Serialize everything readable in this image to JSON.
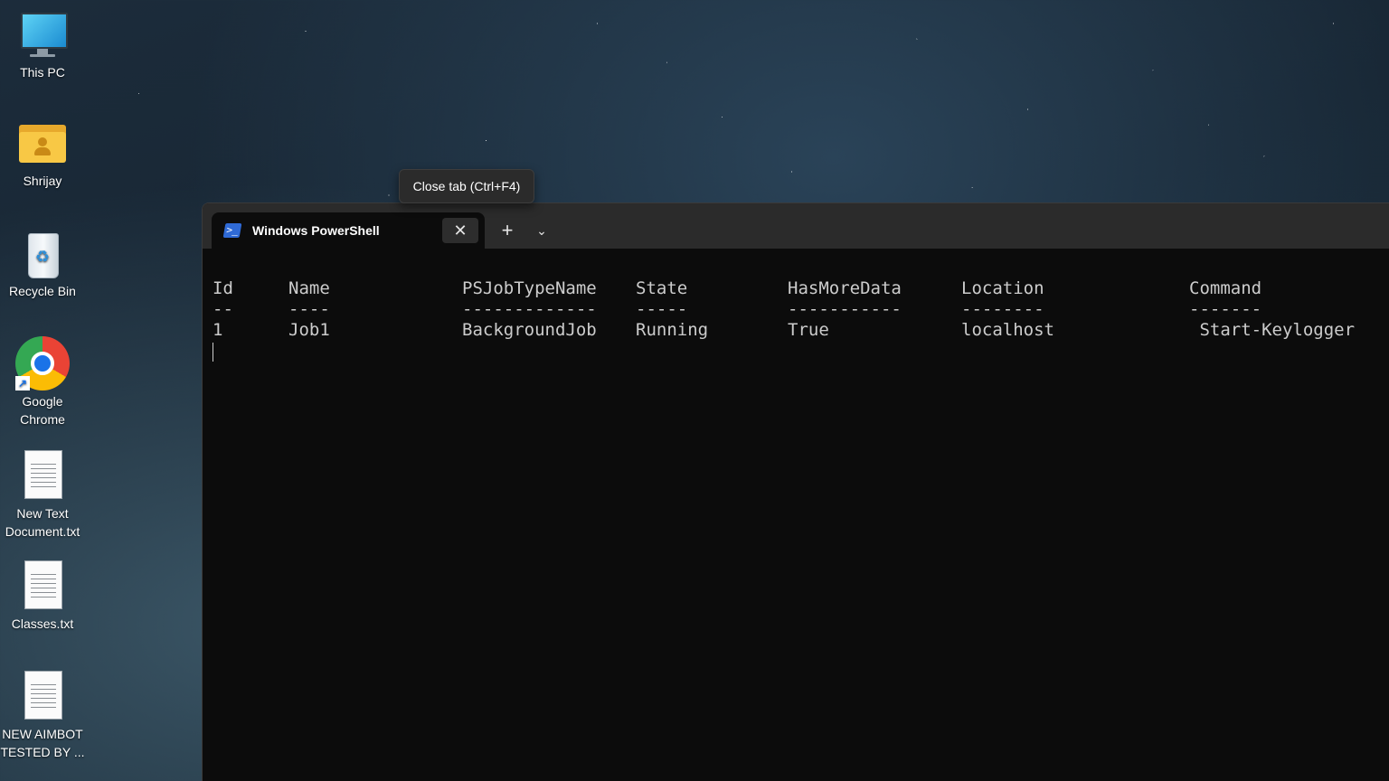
{
  "desktop": {
    "icons": [
      {
        "label": "This PC",
        "icon": "monitor-icon"
      },
      {
        "label": "Shrijay",
        "icon": "user-folder-icon"
      },
      {
        "label": "Recycle Bin",
        "icon": "recycle-bin-icon"
      },
      {
        "label": "Google\nChrome",
        "icon": "chrome-icon"
      },
      {
        "label": "New Text\nDocument.txt",
        "icon": "text-file-icon"
      },
      {
        "label": "Classes.txt",
        "icon": "text-file-icon"
      },
      {
        "label": "NEW AIMBOT\nTESTED BY ...",
        "icon": "text-file-icon"
      }
    ]
  },
  "terminal": {
    "tab_title": "Windows PowerShell",
    "tab_close_glyph": "✕",
    "new_tab_glyph": "+",
    "dropdown_glyph": "⌄",
    "tooltip": "Close tab (Ctrl+F4)",
    "table": {
      "headers": [
        "Id",
        "Name",
        "PSJobTypeName",
        "State",
        "HasMoreData",
        "Location",
        "Command"
      ],
      "separators": [
        "--",
        "----",
        "-------------",
        "-----",
        "-----------",
        "--------",
        "-------"
      ],
      "rows": [
        [
          "1",
          "Job1",
          "BackgroundJob",
          "Running",
          "True",
          "localhost",
          " Start-Keylogger"
        ]
      ]
    }
  },
  "colors": {
    "terminal_bg": "#0c0c0c",
    "titlebar_bg": "#2b2b2b",
    "console_text": "#cccccc",
    "accent": "#2f6ad6"
  }
}
